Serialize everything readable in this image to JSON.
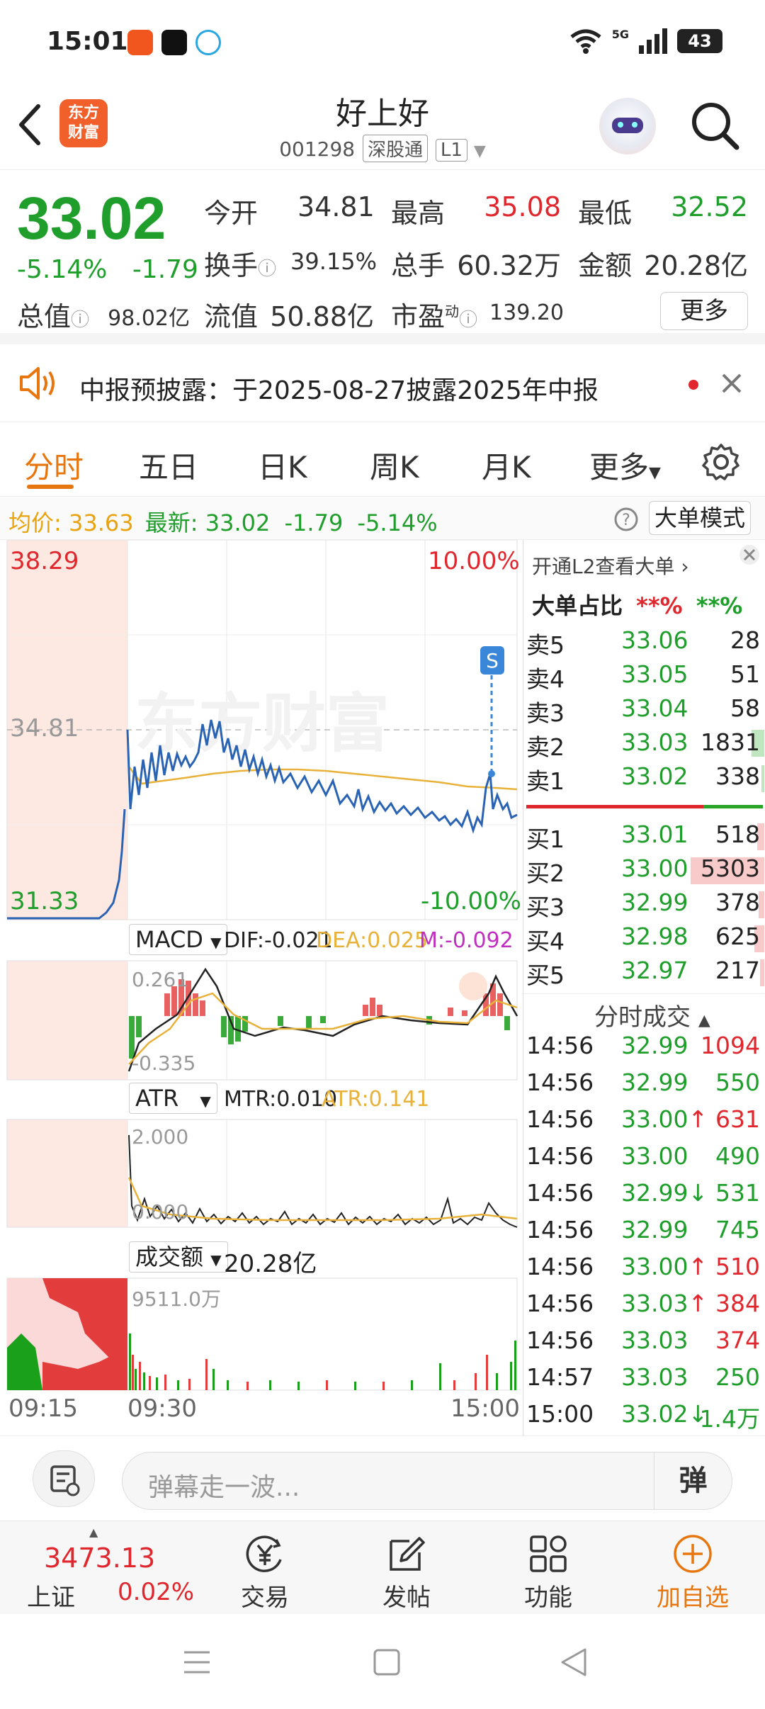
{
  "status": {
    "time": "15:01",
    "battery": "43",
    "network": "5G"
  },
  "header": {
    "logo_text_1": "东方",
    "logo_text_2": "财富",
    "stock_name": "好上好",
    "stock_code": "001298",
    "tag_market": "深股通",
    "tag_level": "L1"
  },
  "quote": {
    "price": "33.02",
    "change_pct": "-5.14%",
    "change_amt": "-1.79",
    "open_label": "今开",
    "open_val": "34.81",
    "high_label": "最高",
    "high_val": "35.08",
    "low_label": "最低",
    "low_val": "32.52",
    "turnover_label": "换手",
    "turnover_val": "39.15%",
    "volume_label": "总手",
    "volume_val": "60.32万",
    "amount_label": "金额",
    "amount_val": "20.28亿",
    "total_cap_label": "总值",
    "total_cap_val": "98.02亿",
    "float_cap_label": "流值",
    "float_cap_val": "50.88亿",
    "pe_label": "市盈",
    "pe_sup": "动",
    "pe_val": "139.20",
    "more_label": "更多"
  },
  "notice": {
    "text": "中报预披露：于2025-08-27披露2025年中报"
  },
  "tabs": [
    "分时",
    "五日",
    "日K",
    "周K",
    "月K",
    "更多"
  ],
  "avg_line": {
    "avg_label": "均价:",
    "avg_val": "33.63",
    "latest_label": "最新:",
    "latest_val": "33.02",
    "chg": "-1.79",
    "pct": "-5.14%",
    "mode_btn": "大单模式"
  },
  "chart": {
    "y_top": "38.29",
    "y_mid": "34.81",
    "y_bot": "31.33",
    "pct_top": "10.00%",
    "pct_bot": "-10.00%",
    "watermark": "东方财富",
    "macd_select": "MACD",
    "macd_dif": "DIF:-0.021",
    "macd_dea": "DEA:0.025",
    "macd_m": "M:-0.092",
    "macd_top": "0.261",
    "macd_bot": "-0.335",
    "atr_select": "ATR",
    "atr_mtr": "MTR:0.010",
    "atr_val": "ATR:0.141",
    "atr_top": "2.000",
    "atr_bot": "0.000",
    "vol_select": "成交额",
    "vol_total": "20.28亿",
    "vol_top": "9511.0万",
    "time_start": "09:15",
    "time_open": "09:30",
    "time_end": "15:00"
  },
  "book": {
    "l2_label": "开通L2查看大单",
    "big_label": "大单占比",
    "big_red": "**%",
    "big_green": "**%",
    "asks": [
      {
        "name": "卖5",
        "price": "33.06",
        "vol": "28"
      },
      {
        "name": "卖4",
        "price": "33.05",
        "vol": "51"
      },
      {
        "name": "卖3",
        "price": "33.04",
        "vol": "58"
      },
      {
        "name": "卖2",
        "price": "33.03",
        "vol": "1831"
      },
      {
        "name": "卖1",
        "price": "33.02",
        "vol": "338"
      }
    ],
    "bids": [
      {
        "name": "买1",
        "price": "33.01",
        "vol": "518"
      },
      {
        "name": "买2",
        "price": "33.00",
        "vol": "5303"
      },
      {
        "name": "买3",
        "price": "32.99",
        "vol": "378"
      },
      {
        "name": "买4",
        "price": "32.98",
        "vol": "625"
      },
      {
        "name": "买5",
        "price": "32.97",
        "vol": "217"
      }
    ],
    "trades_label": "分时成交",
    "trades": [
      {
        "time": "14:56",
        "price": "32.99",
        "vol": "1094",
        "dir": ""
      },
      {
        "time": "14:56",
        "price": "32.99",
        "vol": "550",
        "dir": ""
      },
      {
        "time": "14:56",
        "price": "33.00",
        "vol": "631",
        "dir": "↑"
      },
      {
        "time": "14:56",
        "price": "33.00",
        "vol": "490",
        "dir": ""
      },
      {
        "time": "14:56",
        "price": "32.99",
        "vol": "531",
        "dir": "↓"
      },
      {
        "time": "14:56",
        "price": "32.99",
        "vol": "745",
        "dir": ""
      },
      {
        "time": "14:56",
        "price": "33.00",
        "vol": "510",
        "dir": "↑"
      },
      {
        "time": "14:56",
        "price": "33.03",
        "vol": "384",
        "dir": "↑"
      },
      {
        "time": "14:56",
        "price": "33.03",
        "vol": "374",
        "dir": ""
      },
      {
        "time": "14:57",
        "price": "33.03",
        "vol": "250",
        "dir": ""
      },
      {
        "time": "15:00",
        "price": "33.02",
        "vol": "1.4万",
        "dir": "↓"
      }
    ]
  },
  "comment": {
    "placeholder": "弹幕走一波...",
    "dan": "弹"
  },
  "nav": {
    "index_val": "3473.13",
    "index_name": "上证",
    "index_pct": "0.02%",
    "trade": "交易",
    "post": "发帖",
    "func": "功能",
    "add": "加自选"
  }
}
